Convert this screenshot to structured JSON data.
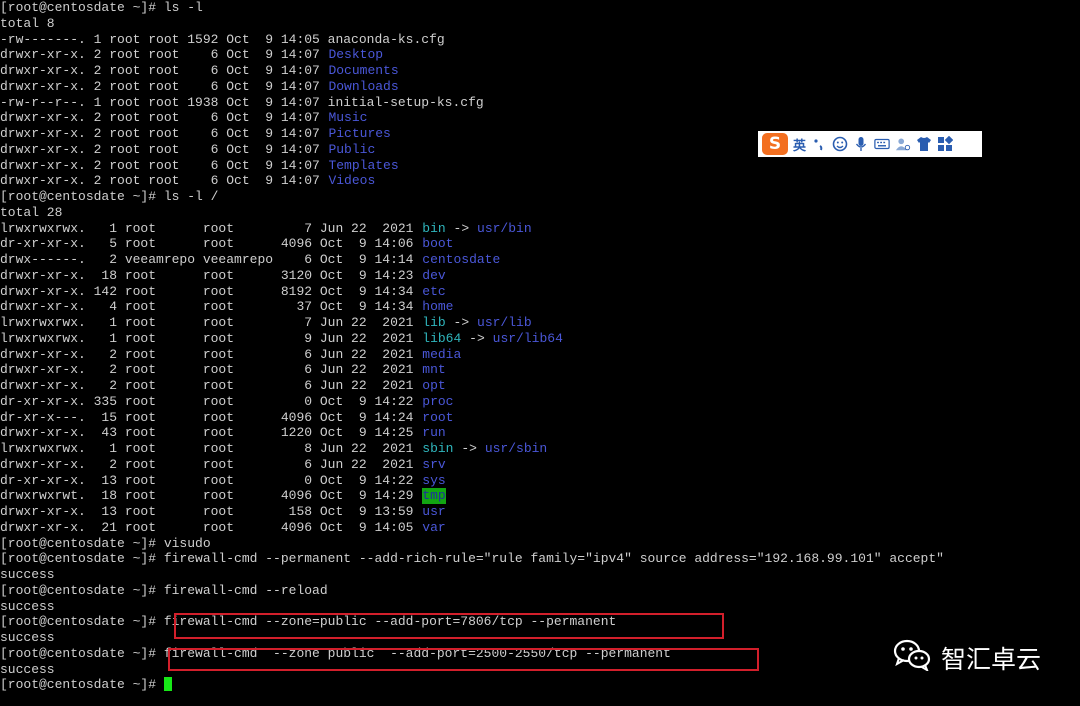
{
  "terminal": {
    "lines": [
      [
        {
          "t": "[root@centosdate ~]# ls -l"
        }
      ],
      [
        {
          "t": "total 8"
        }
      ],
      [
        {
          "t": "-rw-------. 1 root root 1592 Oct  9 14:05 anaconda-ks.cfg"
        }
      ],
      [
        {
          "t": "drwxr-xr-x. 2 root root    6 Oct  9 14:07 "
        },
        {
          "t": "Desktop",
          "s": "dir"
        }
      ],
      [
        {
          "t": "drwxr-xr-x. 2 root root    6 Oct  9 14:07 "
        },
        {
          "t": "Documents",
          "s": "dir"
        }
      ],
      [
        {
          "t": "drwxr-xr-x. 2 root root    6 Oct  9 14:07 "
        },
        {
          "t": "Downloads",
          "s": "dir"
        }
      ],
      [
        {
          "t": "-rw-r--r--. 1 root root 1938 Oct  9 14:07 initial-setup-ks.cfg"
        }
      ],
      [
        {
          "t": "drwxr-xr-x. 2 root root    6 Oct  9 14:07 "
        },
        {
          "t": "Music",
          "s": "dir"
        }
      ],
      [
        {
          "t": "drwxr-xr-x. 2 root root    6 Oct  9 14:07 "
        },
        {
          "t": "Pictures",
          "s": "dir"
        }
      ],
      [
        {
          "t": "drwxr-xr-x. 2 root root    6 Oct  9 14:07 "
        },
        {
          "t": "Public",
          "s": "dir"
        }
      ],
      [
        {
          "t": "drwxr-xr-x. 2 root root    6 Oct  9 14:07 "
        },
        {
          "t": "Templates",
          "s": "dir"
        }
      ],
      [
        {
          "t": "drwxr-xr-x. 2 root root    6 Oct  9 14:07 "
        },
        {
          "t": "Videos",
          "s": "dir"
        }
      ],
      [
        {
          "t": "[root@centosdate ~]# ls -l /"
        }
      ],
      [
        {
          "t": "total 28"
        }
      ],
      [
        {
          "t": "lrwxrwxrwx.   1 root      root         7 Jun 22  2021 "
        },
        {
          "t": "bin",
          "s": "lnk"
        },
        {
          "t": " -> "
        },
        {
          "t": "usr/bin",
          "s": "dir"
        }
      ],
      [
        {
          "t": "dr-xr-xr-x.   5 root      root      4096 Oct  9 14:06 "
        },
        {
          "t": "boot",
          "s": "dir"
        }
      ],
      [
        {
          "t": "drwx------.   2 veeamrepo veeamrepo    6 Oct  9 14:14 "
        },
        {
          "t": "centosdate",
          "s": "dir"
        }
      ],
      [
        {
          "t": "drwxr-xr-x.  18 root      root      3120 Oct  9 14:23 "
        },
        {
          "t": "dev",
          "s": "dir"
        }
      ],
      [
        {
          "t": "drwxr-xr-x. 142 root      root      8192 Oct  9 14:34 "
        },
        {
          "t": "etc",
          "s": "dir"
        }
      ],
      [
        {
          "t": "drwxr-xr-x.   4 root      root        37 Oct  9 14:34 "
        },
        {
          "t": "home",
          "s": "dir"
        }
      ],
      [
        {
          "t": "lrwxrwxrwx.   1 root      root         7 Jun 22  2021 "
        },
        {
          "t": "lib",
          "s": "lnk"
        },
        {
          "t": " -> "
        },
        {
          "t": "usr/lib",
          "s": "dir"
        }
      ],
      [
        {
          "t": "lrwxrwxrwx.   1 root      root         9 Jun 22  2021 "
        },
        {
          "t": "lib64",
          "s": "lnk"
        },
        {
          "t": " -> "
        },
        {
          "t": "usr/lib64",
          "s": "dir"
        }
      ],
      [
        {
          "t": "drwxr-xr-x.   2 root      root         6 Jun 22  2021 "
        },
        {
          "t": "media",
          "s": "dir"
        }
      ],
      [
        {
          "t": "drwxr-xr-x.   2 root      root         6 Jun 22  2021 "
        },
        {
          "t": "mnt",
          "s": "dir"
        }
      ],
      [
        {
          "t": "drwxr-xr-x.   2 root      root         6 Jun 22  2021 "
        },
        {
          "t": "opt",
          "s": "dir"
        }
      ],
      [
        {
          "t": "dr-xr-xr-x. 335 root      root         0 Oct  9 14:22 "
        },
        {
          "t": "proc",
          "s": "dir"
        }
      ],
      [
        {
          "t": "dr-xr-x---.  15 root      root      4096 Oct  9 14:24 "
        },
        {
          "t": "root",
          "s": "dir"
        }
      ],
      [
        {
          "t": "drwxr-xr-x.  43 root      root      1220 Oct  9 14:25 "
        },
        {
          "t": "run",
          "s": "dir"
        }
      ],
      [
        {
          "t": "lrwxrwxrwx.   1 root      root         8 Jun 22  2021 "
        },
        {
          "t": "sbin",
          "s": "lnk"
        },
        {
          "t": " -> "
        },
        {
          "t": "usr/sbin",
          "s": "dir"
        }
      ],
      [
        {
          "t": "drwxr-xr-x.   2 root      root         6 Jun 22  2021 "
        },
        {
          "t": "srv",
          "s": "dir"
        }
      ],
      [
        {
          "t": "dr-xr-xr-x.  13 root      root         0 Oct  9 14:22 "
        },
        {
          "t": "sys",
          "s": "dir"
        }
      ],
      [
        {
          "t": "drwxrwxrwt.  18 root      root      4096 Oct  9 14:29 "
        },
        {
          "t": "tmp",
          "s": "tmp"
        }
      ],
      [
        {
          "t": "drwxr-xr-x.  13 root      root       158 Oct  9 13:59 "
        },
        {
          "t": "usr",
          "s": "dir"
        }
      ],
      [
        {
          "t": "drwxr-xr-x.  21 root      root      4096 Oct  9 14:05 "
        },
        {
          "t": "var",
          "s": "dir"
        }
      ],
      [
        {
          "t": "[root@centosdate ~]# visudo"
        }
      ],
      [
        {
          "t": "[root@centosdate ~]# firewall-cmd --permanent --add-rich-rule=\"rule family=\"ipv4\" source address=\"192.168.99.101\" accept\""
        }
      ],
      [
        {
          "t": "success"
        }
      ],
      [
        {
          "t": "[root@centosdate ~]# firewall-cmd --reload"
        }
      ],
      [
        {
          "t": "success"
        }
      ],
      [
        {
          "t": "[root@centosdate ~]# firewall-cmd --zone=public --add-port=7806/tcp --permanent"
        }
      ],
      [
        {
          "t": "success"
        }
      ],
      [
        {
          "t": "[root@centosdate ~]# firewall-cmd  --zone public  --add-port=2500-2550/tcp --permanent"
        }
      ],
      [
        {
          "t": "success"
        }
      ],
      [
        {
          "t": "[root@centosdate ~]# "
        }
      ]
    ]
  },
  "ime_toolbar": {
    "logo": "S",
    "mode": "英",
    "icons": [
      "punctuation-icon",
      "emoji-icon",
      "microphone-icon",
      "keyboard-icon",
      "user-icon",
      "shirt-icon",
      "grid-icon"
    ]
  },
  "watermark": {
    "icon": "wechat-icon",
    "text": "智汇卓云"
  },
  "colors": {
    "background": "#000000",
    "text": "#cfcfcf",
    "directory": "#4a57d8",
    "symlink": "#2fb6bd",
    "sticky_dir_bg": "#12a512",
    "highlight_box": "#d21f2b",
    "cursor": "#17e817"
  }
}
